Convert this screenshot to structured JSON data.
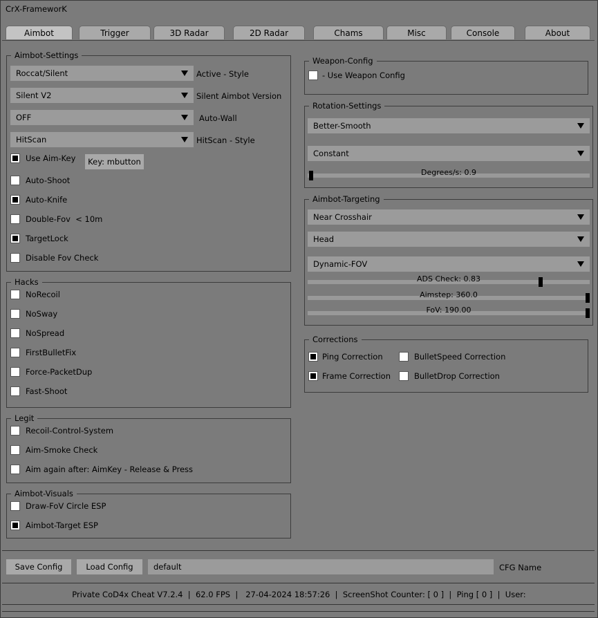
{
  "window": {
    "title": "CrX-FrameworK"
  },
  "tabs": [
    "Aimbot",
    "Trigger",
    "3D Radar",
    "2D Radar",
    "Chams",
    "Misc",
    "Console",
    "About"
  ],
  "aimbot_settings": {
    "legend": "Aimbot-Settings",
    "active_style": {
      "value": "Roccat/Silent",
      "label": "Active - Style"
    },
    "silent_version": {
      "value": "Silent V2",
      "label": "Silent Aimbot Version"
    },
    "auto_wall": {
      "value": "OFF",
      "label": "Auto-Wall"
    },
    "hitscan": {
      "value": "HitScan",
      "label": "HitScan - Style"
    },
    "use_aim_key": {
      "label": "Use Aim-Key",
      "checked": true
    },
    "key_button": "Key: mbutton",
    "auto_shoot": {
      "label": "Auto-Shoot",
      "checked": false
    },
    "auto_knife": {
      "label": "Auto-Knife",
      "checked": true
    },
    "double_fov": {
      "label": "Double-Fov  < 10m",
      "checked": false
    },
    "target_lock": {
      "label": "TargetLock",
      "checked": true
    },
    "disable_fov_check": {
      "label": "Disable Fov Check",
      "checked": false
    }
  },
  "hacks": {
    "legend": "Hacks",
    "items": [
      {
        "label": "NoRecoil",
        "checked": false
      },
      {
        "label": "NoSway",
        "checked": false
      },
      {
        "label": "NoSpread",
        "checked": false
      },
      {
        "label": "FirstBulletFix",
        "checked": false
      },
      {
        "label": "Force-PacketDup",
        "checked": false
      },
      {
        "label": "Fast-Shoot",
        "checked": false
      }
    ]
  },
  "legit": {
    "legend": "Legit",
    "items": [
      {
        "label": "Recoil-Control-System",
        "checked": false
      },
      {
        "label": "Aim-Smoke Check",
        "checked": false
      },
      {
        "label": "Aim again after: AimKey - Release & Press",
        "checked": false
      }
    ]
  },
  "aimbot_visuals": {
    "legend": "Aimbot-Visuals",
    "items": [
      {
        "label": "Draw-FoV Circle ESP",
        "checked": false
      },
      {
        "label": "Aimbot-Target ESP",
        "checked": true
      }
    ]
  },
  "weapon_config": {
    "legend": "Weapon-Config",
    "use_weapon_config": {
      "label": "- Use Weapon Config",
      "checked": false
    }
  },
  "rotation": {
    "legend": "Rotation-Settings",
    "mode": "Better-Smooth",
    "speed_type": "Constant",
    "degrees": {
      "label": "Degrees/s: 0.9",
      "fraction": 0.005
    }
  },
  "targeting": {
    "legend": "Aimbot-Targeting",
    "priority": "Near Crosshair",
    "bone": "Head",
    "fov_mode": "Dynamic-FOV",
    "ads_check": {
      "label": "ADS Check: 0.83",
      "fraction": 0.83
    },
    "aimstep": {
      "label": "Aimstep: 360.0",
      "fraction": 1.0
    },
    "fov": {
      "label": "FoV: 190.00",
      "fraction": 1.0
    }
  },
  "corrections": {
    "legend": "Corrections",
    "ping": {
      "label": "Ping Correction",
      "checked": true
    },
    "bullet_speed": {
      "label": "BulletSpeed Correction",
      "checked": false
    },
    "frame": {
      "label": "Frame Correction",
      "checked": true
    },
    "bullet_drop": {
      "label": "BulletDrop Correction",
      "checked": false
    }
  },
  "footer": {
    "save": "Save Config",
    "load": "Load Config",
    "cfg_value": "default",
    "cfg_label": "CFG Name",
    "status": "Private CoD4x Cheat V7.2.4  |  62.0 FPS  |   27-04-2024 18:57:26  |  ScreenShot Counter: [ 0 ]  |  Ping [ 0 ]  |  User:"
  }
}
